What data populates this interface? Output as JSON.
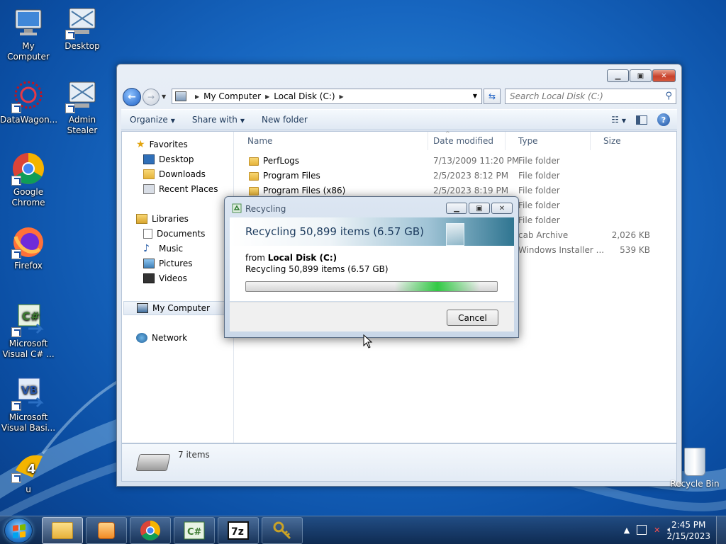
{
  "desktop": {
    "icons": [
      {
        "label": "My Computer"
      },
      {
        "label": "Desktop"
      },
      {
        "label": "DataWagon..."
      },
      {
        "label": "Admin Stealer"
      },
      {
        "label": "Google Chrome"
      },
      {
        "label": "Firefox"
      },
      {
        "label": "Microsoft Visual C# ..."
      },
      {
        "label": "Microsoft Visual Basi..."
      },
      {
        "label": "u"
      }
    ],
    "recycle_bin": "Recycle Bin"
  },
  "explorer": {
    "breadcrumb": [
      "My Computer",
      "Local Disk (C:)"
    ],
    "search_placeholder": "Search Local Disk (C:)",
    "toolbar": {
      "organize": "Organize",
      "share_with": "Share with",
      "new_folder": "New folder"
    },
    "nav": {
      "favorites": "Favorites",
      "desktop": "Desktop",
      "downloads": "Downloads",
      "recent_places": "Recent Places",
      "libraries": "Libraries",
      "documents": "Documents",
      "music": "Music",
      "pictures": "Pictures",
      "videos": "Videos",
      "my_computer": "My Computer",
      "network": "Network"
    },
    "columns": {
      "name": "Name",
      "date": "Date modified",
      "type": "Type",
      "size": "Size"
    },
    "files": [
      {
        "name": "PerfLogs",
        "date": "7/13/2009 11:20 PM",
        "type": "File folder",
        "size": ""
      },
      {
        "name": "Program Files",
        "date": "2/5/2023 8:12 PM",
        "type": "File folder",
        "size": ""
      },
      {
        "name": "Program Files (x86)",
        "date": "2/5/2023 8:19 PM",
        "type": "File folder",
        "size": ""
      },
      {
        "name": "",
        "date": "",
        "type": "File folder",
        "size": ""
      },
      {
        "name": "",
        "date": "",
        "type": "File folder",
        "size": ""
      },
      {
        "name": "",
        "date": "",
        "type": "cab Archive",
        "size": "2,026 KB"
      },
      {
        "name": "",
        "date": "",
        "type": "Windows Installer ...",
        "size": "539 KB"
      }
    ],
    "status": "7 items"
  },
  "dialog": {
    "title": "Recycling",
    "headline": "Recycling 50,899 items (6.57 GB)",
    "from_label": "from",
    "from_location": "Local Disk (C:)",
    "subline": "Recycling 50,899 items (6.57 GB)",
    "cancel": "Cancel",
    "progress_fraction": 0.0
  },
  "taskbar": {
    "clock_time": "2:45 PM",
    "clock_date": "2/15/2023"
  },
  "colors": {
    "accent": "#1c5fc4",
    "progress_green": "#28c83c"
  }
}
